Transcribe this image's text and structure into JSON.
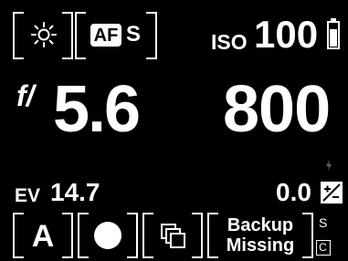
{
  "top_row": {
    "white_balance_icon": "sun-icon",
    "af_label": "AF",
    "af_mode": "S",
    "iso_label": "ISO",
    "iso_value": "100",
    "battery_icon": "battery-icon"
  },
  "exposure": {
    "aperture_prefix": "f/",
    "aperture_value": "5.6",
    "shutter_value": "800",
    "flash_icon": "flash-icon"
  },
  "metering": {
    "ev_label": "EV",
    "ev_value": "14.7",
    "compensation_value": "0.0",
    "compensation_icon": "exposure-compensation-icon"
  },
  "bottom_row": {
    "mode_label": "A",
    "metering_icon": "spot-metering-icon",
    "drive_icon": "drive-mode-icon",
    "backup_line1": "Backup",
    "backup_line2": "Missing",
    "slot_s": "S",
    "slot_c": "C"
  },
  "colors": {
    "foreground": "#ffffff",
    "background": "#000000",
    "dim": "#777777"
  }
}
